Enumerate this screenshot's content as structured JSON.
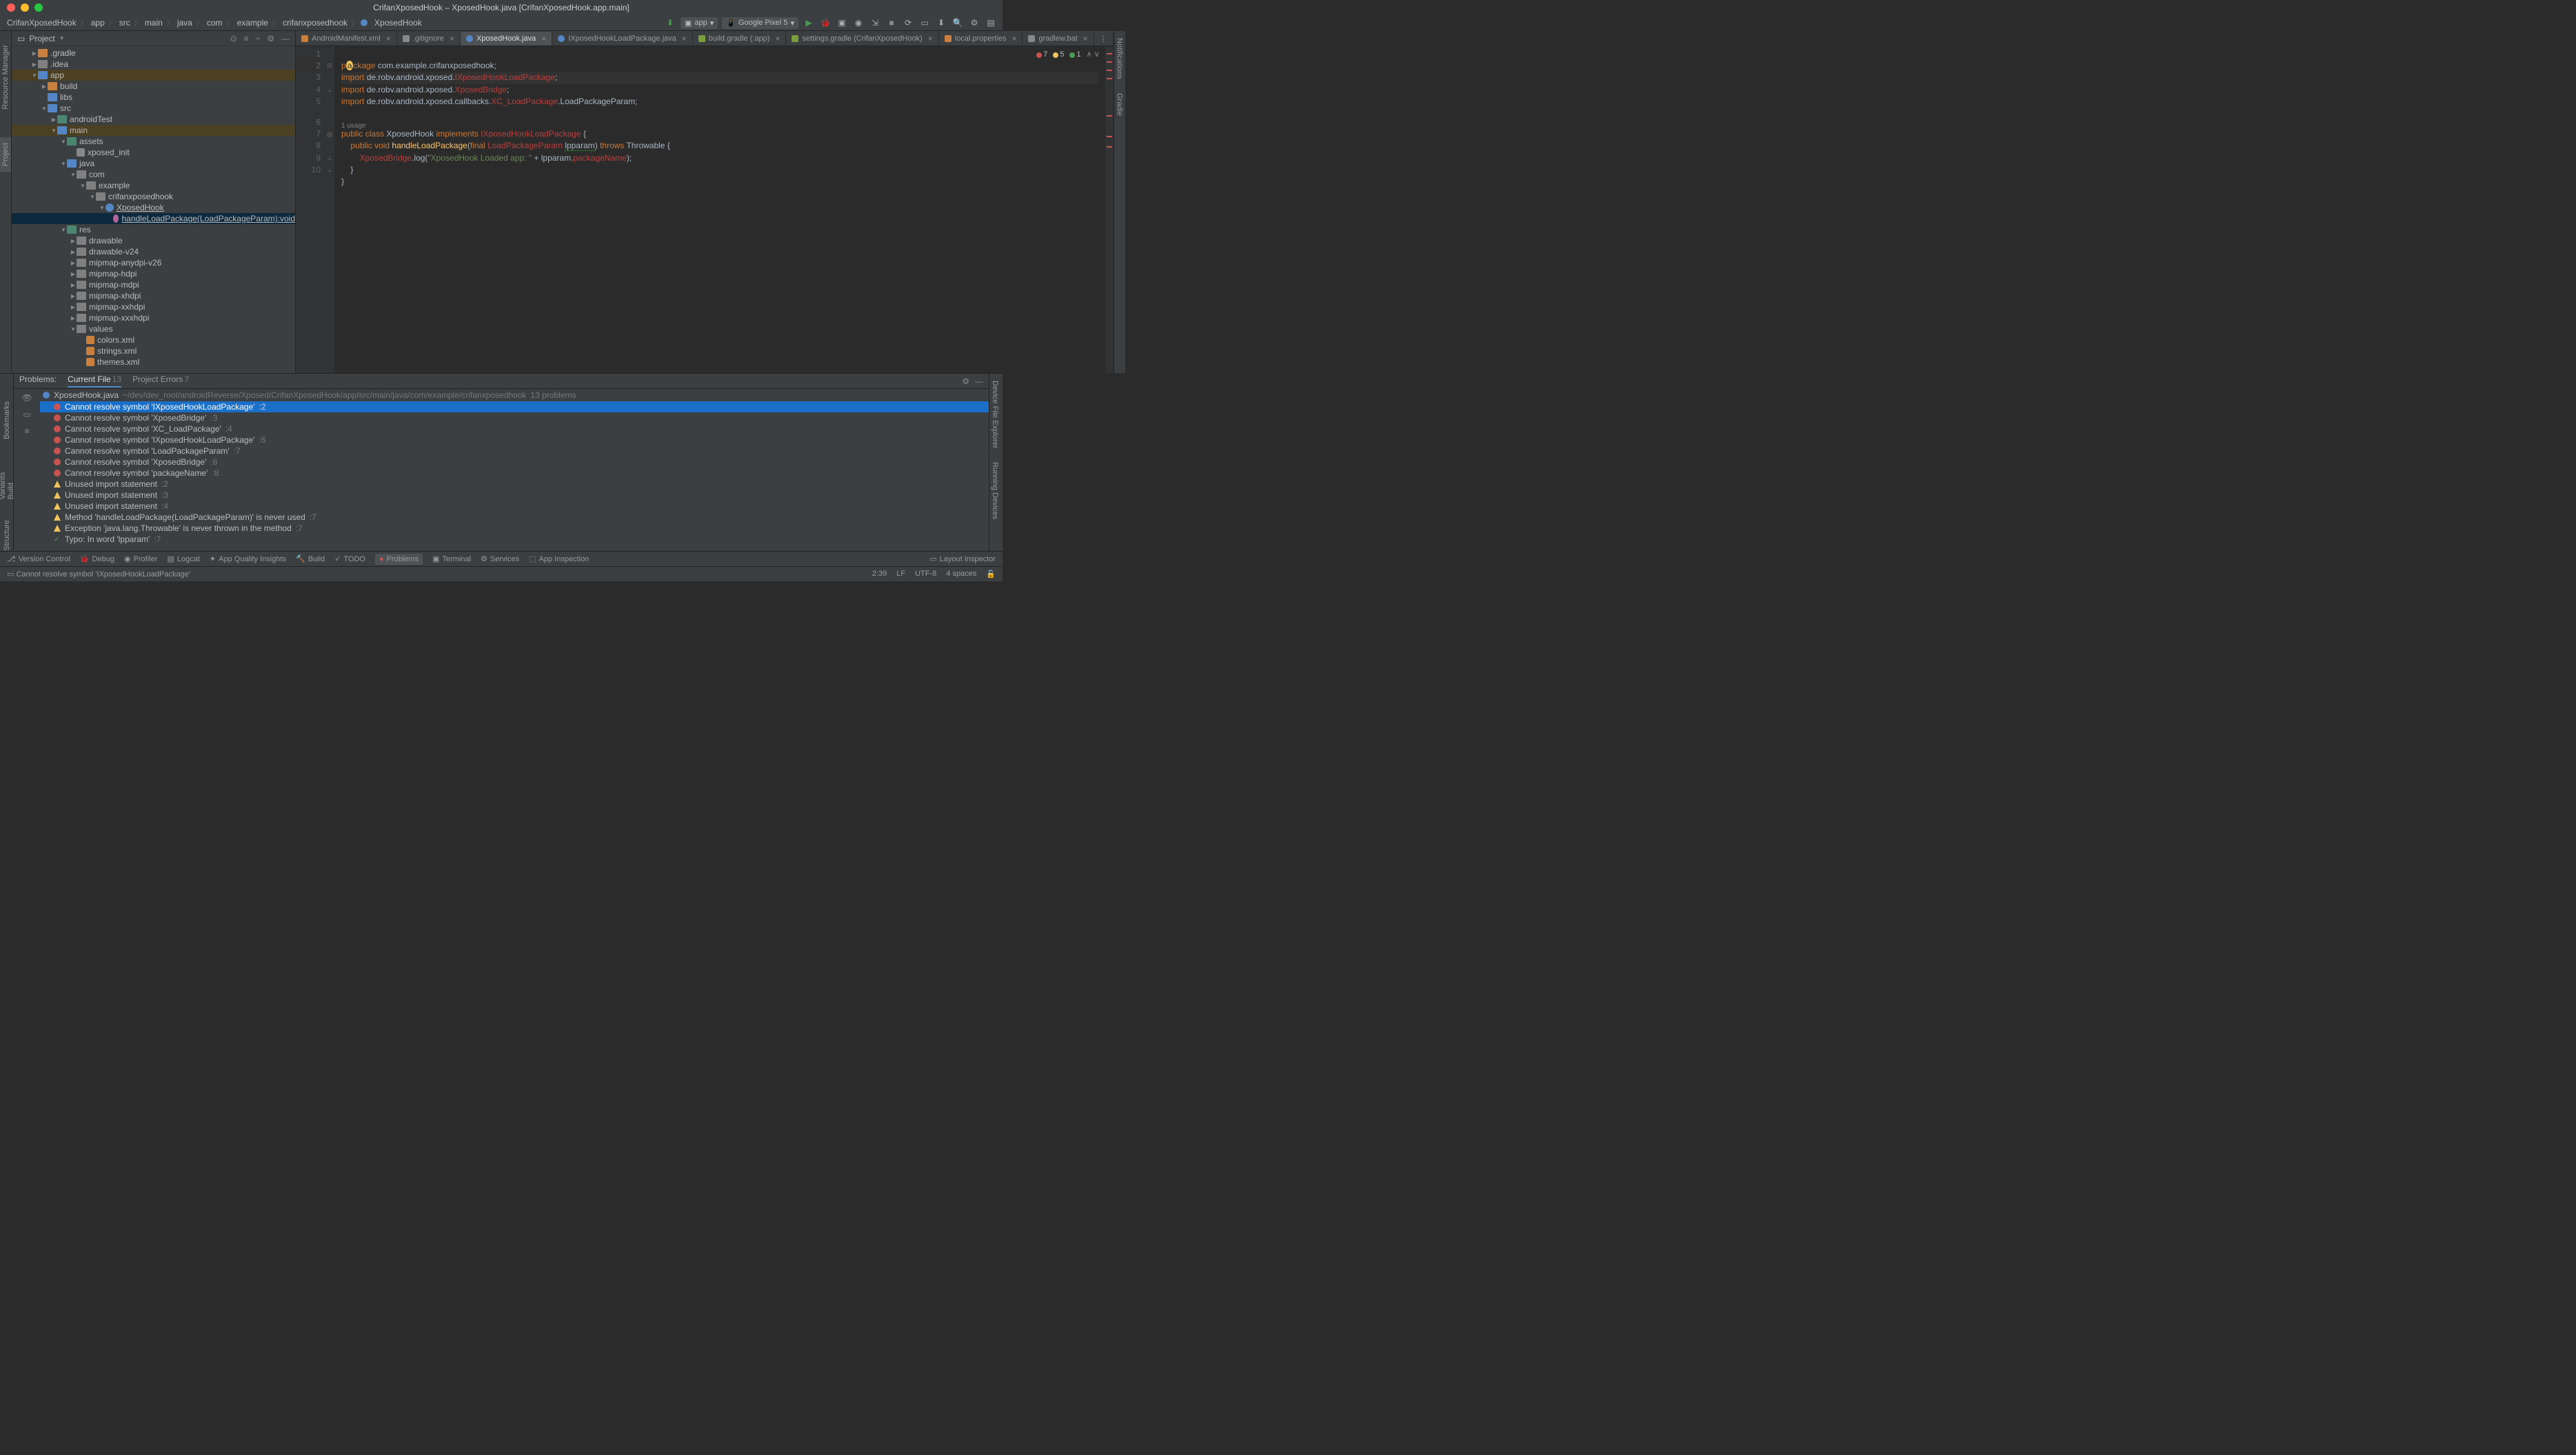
{
  "title": "CrifanXposedHook – XposedHook.java [CrifanXposedHook.app.main]",
  "breadcrumb": [
    "CrifanXposedHook",
    "app",
    "src",
    "main",
    "java",
    "com",
    "example",
    "crifanxposedhook",
    "XposedHook"
  ],
  "run_config": {
    "app": "app",
    "device": "Google Pixel 5"
  },
  "project_label": "Project",
  "tree": [
    {
      "d": 2,
      "a": ">",
      "ic": "orange",
      "l": ".gradle"
    },
    {
      "d": 2,
      "a": ">",
      "ic": "gray",
      "l": ".idea"
    },
    {
      "d": 2,
      "a": "v",
      "ic": "blue",
      "l": "app",
      "hl": true
    },
    {
      "d": 3,
      "a": ">",
      "ic": "orange",
      "l": "build"
    },
    {
      "d": 3,
      "a": "",
      "ic": "blue",
      "l": "libs"
    },
    {
      "d": 3,
      "a": "v",
      "ic": "blue",
      "l": "src"
    },
    {
      "d": 4,
      "a": ">",
      "ic": "teal",
      "l": "androidTest"
    },
    {
      "d": 4,
      "a": "v",
      "ic": "blue",
      "l": "main",
      "hl": true
    },
    {
      "d": 5,
      "a": "v",
      "ic": "teal",
      "l": "assets"
    },
    {
      "d": 6,
      "a": "",
      "ic": "file",
      "l": "xposed_init"
    },
    {
      "d": 5,
      "a": "v",
      "ic": "blue",
      "l": "java"
    },
    {
      "d": 6,
      "a": "v",
      "ic": "gray",
      "l": "com"
    },
    {
      "d": 7,
      "a": "v",
      "ic": "gray",
      "l": "example"
    },
    {
      "d": 8,
      "a": "v",
      "ic": "gray",
      "l": "crifanxposedhook"
    },
    {
      "d": 9,
      "a": "v",
      "ic": "class",
      "l": "XposedHook",
      "u": true
    },
    {
      "d": 10,
      "a": "",
      "ic": "method",
      "l": "handleLoadPackage(LoadPackageParam):void",
      "sel": true,
      "u": true
    },
    {
      "d": 5,
      "a": "v",
      "ic": "teal",
      "l": "res"
    },
    {
      "d": 6,
      "a": ">",
      "ic": "gray",
      "l": "drawable"
    },
    {
      "d": 6,
      "a": ">",
      "ic": "gray",
      "l": "drawable-v24"
    },
    {
      "d": 6,
      "a": ">",
      "ic": "gray",
      "l": "mipmap-anydpi-v26"
    },
    {
      "d": 6,
      "a": ">",
      "ic": "gray",
      "l": "mipmap-hdpi"
    },
    {
      "d": 6,
      "a": ">",
      "ic": "gray",
      "l": "mipmap-mdpi"
    },
    {
      "d": 6,
      "a": ">",
      "ic": "gray",
      "l": "mipmap-xhdpi"
    },
    {
      "d": 6,
      "a": ">",
      "ic": "gray",
      "l": "mipmap-xxhdpi"
    },
    {
      "d": 6,
      "a": ">",
      "ic": "gray",
      "l": "mipmap-xxxhdpi"
    },
    {
      "d": 6,
      "a": "v",
      "ic": "gray",
      "l": "values"
    },
    {
      "d": 7,
      "a": "",
      "ic": "xml",
      "l": "colors.xml"
    },
    {
      "d": 7,
      "a": "",
      "ic": "xml",
      "l": "strings.xml"
    },
    {
      "d": 7,
      "a": "",
      "ic": "xml",
      "l": "themes.xml"
    }
  ],
  "tabs": [
    {
      "l": "AndroidManifest.xml",
      "ic": "ti-xml"
    },
    {
      "l": ".gitignore",
      "ic": "ti-file"
    },
    {
      "l": "XposedHook.java",
      "ic": "ti-class",
      "active": true
    },
    {
      "l": "IXposedHookLoadPackage.java",
      "ic": "ti-class"
    },
    {
      "l": "build.gradle (:app)",
      "ic": "ti-gradle"
    },
    {
      "l": "settings.gradle (CrifanXposedHook)",
      "ic": "ti-gradle"
    },
    {
      "l": "local.properties",
      "ic": "ti-prop"
    },
    {
      "l": "gradlew.bat",
      "ic": "ti-file"
    }
  ],
  "inspection": {
    "errors": "7",
    "warnings": "5",
    "ok": "1"
  },
  "code_usage": "1 usage",
  "left_tools": [
    "Resource Manager",
    "Project"
  ],
  "right_tools": [
    "Notifications",
    "Gradle",
    "Device File Explorer",
    "Running Devices"
  ],
  "problems": {
    "label": "Problems:",
    "tabs": [
      {
        "l": "Current File",
        "c": "13",
        "active": true
      },
      {
        "l": "Project Errors",
        "c": "7"
      }
    ],
    "file": {
      "name": "XposedHook.java",
      "path": "~/dev/dev_root/androidReverse/Xposed/CrifanXposedHook/app/src/main/java/com/example/crifanxposedhook",
      "count": "13 problems"
    },
    "items": [
      {
        "t": "err",
        "msg": "Cannot resolve symbol 'IXposedHookLoadPackage'",
        "loc": ":2",
        "sel": true
      },
      {
        "t": "err",
        "msg": "Cannot resolve symbol 'XposedBridge'",
        "loc": ":3"
      },
      {
        "t": "err",
        "msg": "Cannot resolve symbol 'XC_LoadPackage'",
        "loc": ":4"
      },
      {
        "t": "err",
        "msg": "Cannot resolve symbol 'IXposedHookLoadPackage'",
        "loc": ":6"
      },
      {
        "t": "err",
        "msg": "Cannot resolve symbol 'LoadPackageParam'",
        "loc": ":7"
      },
      {
        "t": "err",
        "msg": "Cannot resolve symbol 'XposedBridge'",
        "loc": ":8"
      },
      {
        "t": "err",
        "msg": "Cannot resolve symbol 'packageName'",
        "loc": ":8"
      },
      {
        "t": "warn",
        "msg": "Unused import statement",
        "loc": ":2"
      },
      {
        "t": "warn",
        "msg": "Unused import statement",
        "loc": ":3"
      },
      {
        "t": "warn",
        "msg": "Unused import statement",
        "loc": ":4"
      },
      {
        "t": "warn",
        "msg": "Method 'handleLoadPackage(LoadPackageParam)' is never used",
        "loc": ":7"
      },
      {
        "t": "warn",
        "msg": "Exception 'java.lang.Throwable' is never thrown in the method",
        "loc": ":7"
      },
      {
        "t": "typo",
        "msg": "Typo: In word 'lpparam'",
        "loc": ":7"
      }
    ]
  },
  "bottom_tools": [
    "Version Control",
    "Debug",
    "Profiler",
    "Logcat",
    "App Quality Insights",
    "Build",
    "TODO",
    "Problems",
    "Terminal",
    "Services",
    "App Inspection"
  ],
  "bottom_right": "Layout Inspector",
  "status": {
    "msg": "Cannot resolve symbol 'IXposedHookLoadPackage'",
    "right": [
      "2:39",
      "LF",
      "UTF-8",
      "4 spaces"
    ]
  }
}
